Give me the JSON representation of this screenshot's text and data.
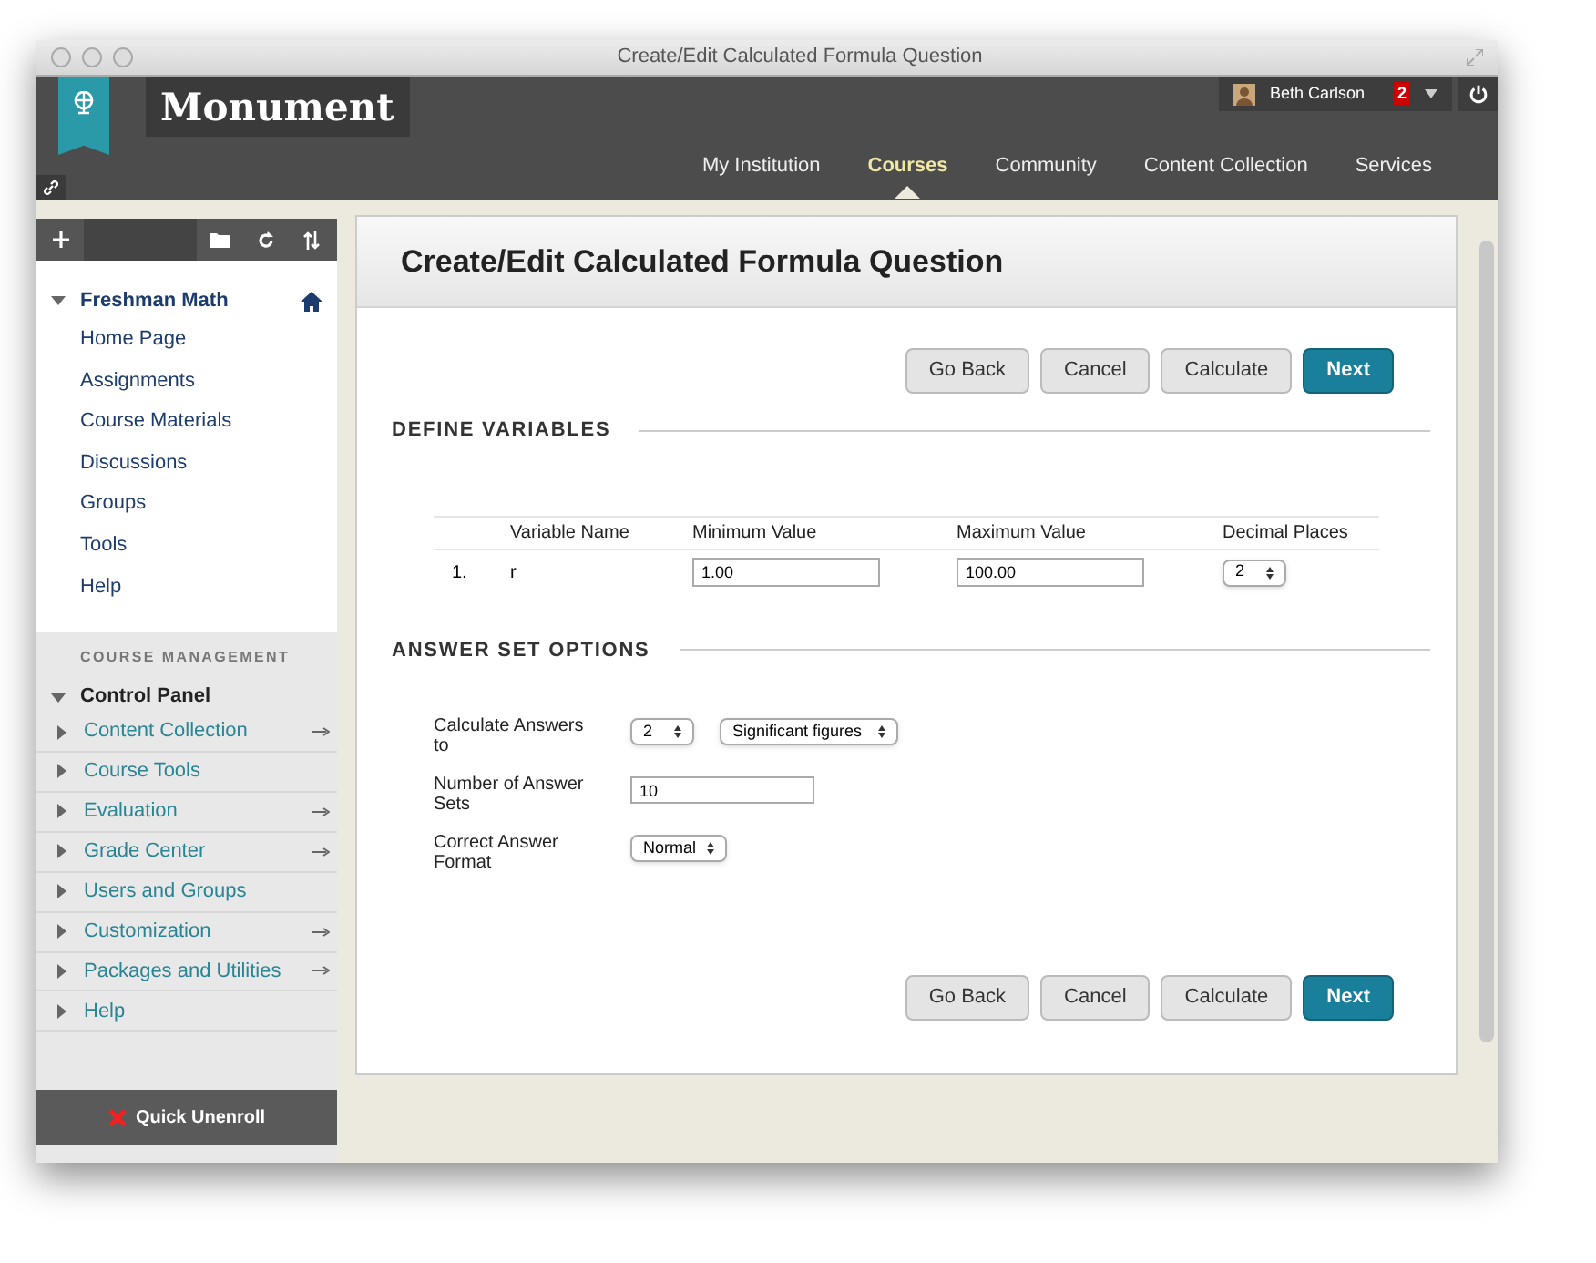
{
  "window": {
    "title": "Create/Edit Calculated Formula Question"
  },
  "header": {
    "brand": "Monument",
    "user": {
      "name": "Beth Carlson",
      "notifications": "2"
    },
    "nav": [
      {
        "label": "My Institution",
        "selected": false
      },
      {
        "label": "Courses",
        "selected": true
      },
      {
        "label": "Community",
        "selected": false
      },
      {
        "label": "Content Collection",
        "selected": false
      },
      {
        "label": "Services",
        "selected": false
      }
    ]
  },
  "sidebar": {
    "course": {
      "title": "Freshman Math",
      "expanded": true,
      "items": [
        "Home Page",
        "Assignments",
        "Course Materials",
        "Discussions",
        "Groups",
        "Tools",
        "Help"
      ]
    },
    "management_heading": "COURSE MANAGEMENT",
    "control_panel": {
      "title": "Control Panel",
      "expanded": true,
      "items": [
        {
          "label": "Content Collection",
          "has_arrow": true
        },
        {
          "label": "Course Tools",
          "has_arrow": false
        },
        {
          "label": "Evaluation",
          "has_arrow": true
        },
        {
          "label": "Grade Center",
          "has_arrow": true
        },
        {
          "label": "Users and Groups",
          "has_arrow": false
        },
        {
          "label": "Customization",
          "has_arrow": true
        },
        {
          "label": "Packages and Utilities",
          "has_arrow": true
        },
        {
          "label": "Help",
          "has_arrow": false
        }
      ]
    },
    "quick_unenroll": "Quick Unenroll"
  },
  "main": {
    "title": "Create/Edit Calculated Formula Question",
    "top_buttons": [
      {
        "label": "Go Back",
        "kind": "default"
      },
      {
        "label": "Cancel",
        "kind": "default"
      },
      {
        "label": "Calculate",
        "kind": "default"
      },
      {
        "label": "Next",
        "kind": "primary"
      }
    ],
    "variables": {
      "heading": "DEFINE VARIABLES",
      "columns": [
        "Variable Name",
        "Minimum Value",
        "Maximum Value",
        "Decimal Places"
      ],
      "rows": [
        {
          "number": "1.",
          "name": "r",
          "min": "1.00",
          "max": "100.00",
          "decimals": "2"
        }
      ]
    },
    "answer_options": {
      "heading": "ANSWER SET OPTIONS",
      "fields": [
        {
          "label": "Calculate Answers to",
          "controls": [
            {
              "kind": "select",
              "value": "2"
            },
            {
              "kind": "select",
              "value": "Significant figures"
            }
          ]
        },
        {
          "label": "Number of Answer Sets",
          "controls": [
            {
              "kind": "input",
              "value": "10"
            }
          ]
        },
        {
          "label": "Correct Answer Format",
          "controls": [
            {
              "kind": "select",
              "value": "Normal"
            }
          ]
        }
      ]
    },
    "bottom_buttons": [
      {
        "label": "Go Back",
        "kind": "default"
      },
      {
        "label": "Cancel",
        "kind": "default"
      },
      {
        "label": "Calculate",
        "kind": "default"
      },
      {
        "label": "Next",
        "kind": "primary"
      }
    ]
  }
}
